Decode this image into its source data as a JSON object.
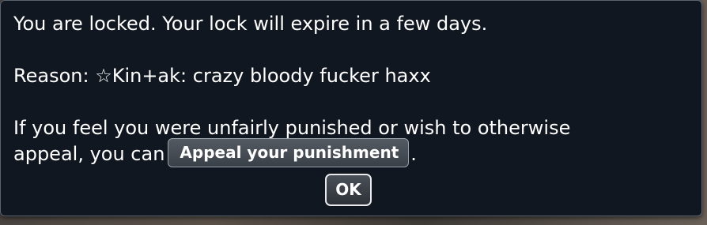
{
  "popup": {
    "lock_message": "You are locked. Your lock will expire in a few days.",
    "reason_label": "Reason: ",
    "reason_text": "☆Kin+ak: crazy bloody fucker haxx",
    "appeal_line1": "If you feel you were unfairly punished or wish to otherwise",
    "appeal_line2_prefix": "appeal, you can",
    "appeal_button_label": "Appeal your punishment",
    "appeal_line2_suffix": ".",
    "ok_button_label": "OK"
  },
  "colors": {
    "popup_background": "#111720",
    "text": "#ffffff",
    "button_border": "#9aa2ac"
  }
}
